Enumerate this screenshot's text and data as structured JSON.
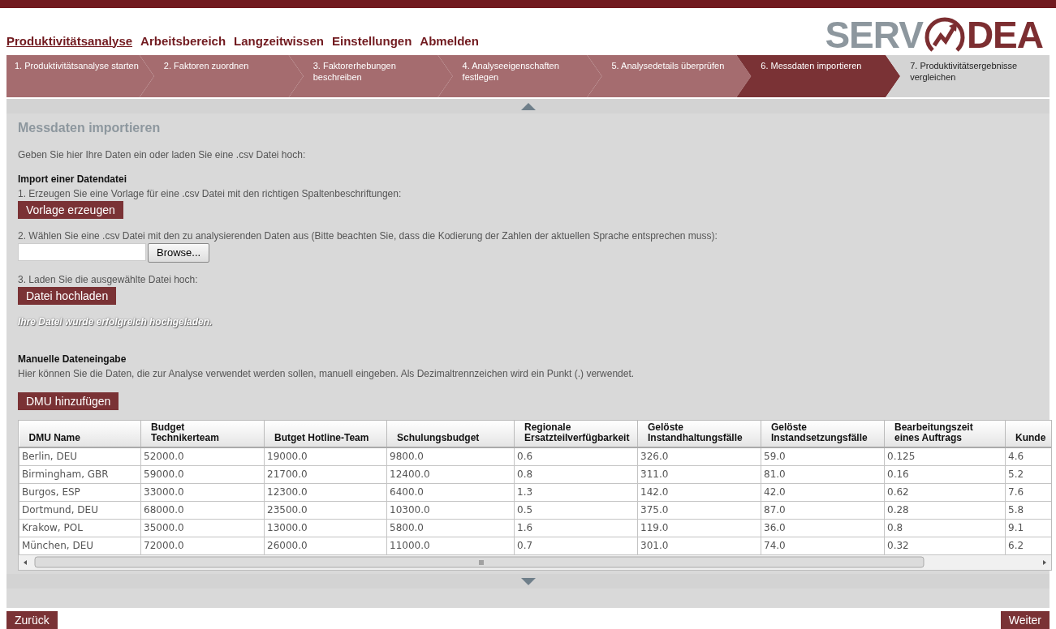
{
  "logo": {
    "left": "SERV",
    "right": "DEA"
  },
  "nav": [
    {
      "label": "Produktivitätsanalyse",
      "selected": true
    },
    {
      "label": "Arbeitsbereich",
      "selected": false
    },
    {
      "label": "Langzeitwissen",
      "selected": false
    },
    {
      "label": "Einstellungen",
      "selected": false
    },
    {
      "label": "Abmelden",
      "selected": false
    }
  ],
  "steps": [
    {
      "label": "1. Produktivitätsanalyse starten",
      "completed": true,
      "selected": false
    },
    {
      "label": "2. Faktoren zuordnen",
      "completed": true,
      "selected": false
    },
    {
      "label": "3. Faktorerhebungen beschreiben",
      "completed": true,
      "selected": false
    },
    {
      "label": "4. Analyseeigenschaften festlegen",
      "completed": true,
      "selected": false
    },
    {
      "label": "5. Analysedetails überprüfen",
      "completed": true,
      "selected": false
    },
    {
      "label": "6. Messdaten importieren",
      "completed": false,
      "selected": true
    },
    {
      "label": "7. Produktivitätsergebnisse vergleichen",
      "completed": false,
      "selected": false
    }
  ],
  "page": {
    "title": "Messdaten importieren",
    "intro": "Geben Sie hier Ihre Daten ein oder laden Sie eine .csv Datei hoch:"
  },
  "import": {
    "heading": "Import einer Datendatei",
    "step1": "1. Erzeugen Sie eine Vorlage für eine .csv Datei mit den richtigen Spaltenbeschriftungen:",
    "template_button": "Vorlage erzeugen",
    "step2": "2. Wählen Sie eine .csv Datei mit den zu analysierenden Daten aus (Bitte beachten Sie, dass die Kodierung der Zahlen der aktuellen Sprache entsprechen muss):",
    "browse_button": "Browse...",
    "step3": "3. Laden Sie die ausgewählte Datei hoch:",
    "upload_button": "Datei hochladen",
    "success": "Ihre Datei wurde erfolgreich hochgeladen."
  },
  "manual": {
    "heading": "Manuelle Dateneingabe",
    "text": "Hier können Sie die Daten, die zur Analyse verwendet werden sollen, manuell eingeben. Als Dezimaltrennzeichen wird ein Punkt (.) verwendet.",
    "add_button": "DMU hinzufügen"
  },
  "table": {
    "columns": [
      {
        "lines": [
          "DMU Name"
        ]
      },
      {
        "lines": [
          "Budget",
          "Technikerteam"
        ]
      },
      {
        "lines": [
          "Butget Hotline-Team"
        ]
      },
      {
        "lines": [
          "Schulungsbudget"
        ]
      },
      {
        "lines": [
          "Regionale",
          "Ersatzteilverfügbarkeit"
        ]
      },
      {
        "lines": [
          "Gelöste",
          "Instandhaltungsfälle"
        ]
      },
      {
        "lines": [
          "Gelöste",
          "Instandsetzungsfälle"
        ]
      },
      {
        "lines": [
          "Bearbeitungszeit",
          "eines Auftrags"
        ]
      },
      {
        "lines": [
          "Kunde"
        ]
      }
    ],
    "rows": [
      [
        "Berlin, DEU",
        "52000.0",
        "19000.0",
        "9800.0",
        "0.6",
        "326.0",
        "59.0",
        "0.125",
        "4.6"
      ],
      [
        "Birmingham, GBR",
        "59000.0",
        "21700.0",
        "12400.0",
        "0.8",
        "311.0",
        "81.0",
        "0.16",
        "5.2"
      ],
      [
        "Burgos, ESP",
        "33000.0",
        "12300.0",
        "6400.0",
        "1.3",
        "142.0",
        "42.0",
        "0.62",
        "7.6"
      ],
      [
        "Dortmund, DEU",
        "68000.0",
        "23500.0",
        "10300.0",
        "0.5",
        "375.0",
        "87.0",
        "0.28",
        "5.8"
      ],
      [
        "Krakow, POL",
        "35000.0",
        "13000.0",
        "5800.0",
        "1.6",
        "119.0",
        "36.0",
        "0.8",
        "9.1"
      ],
      [
        "München, DEU",
        "72000.0",
        "26000.0",
        "11000.0",
        "0.7",
        "301.0",
        "74.0",
        "0.32",
        "6.2"
      ]
    ]
  },
  "footer": {
    "back": "Zurück",
    "next": "Weiter"
  }
}
